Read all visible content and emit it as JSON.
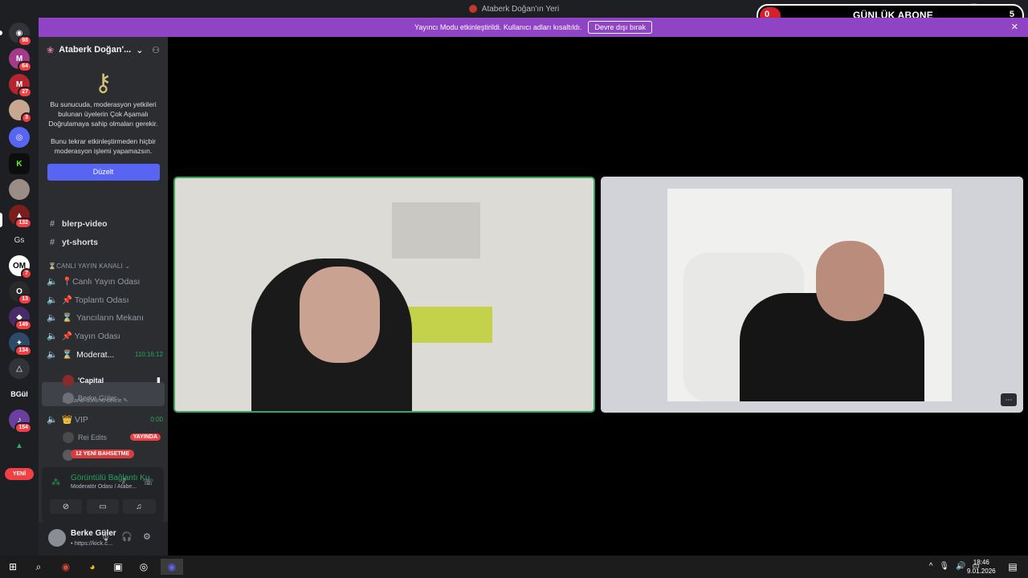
{
  "window": {
    "title": "Ataberk Doğan'ın Yeri"
  },
  "overlay": {
    "start": "0",
    "label": "GÜNLÜK ABONE",
    "goal": "5"
  },
  "banner": {
    "message": "Yayıncı Modu etkinleştirildi. Kullanıcı adları kısaltıldı.",
    "button": "Devre dışı bırak",
    "close": "✕"
  },
  "servers": [
    {
      "label": "98"
    },
    {
      "label": "64"
    },
    {
      "label": "27"
    },
    {
      "label": "3"
    },
    {
      "label": ""
    },
    {
      "label": ""
    },
    {
      "label": ""
    },
    {
      "label": "132"
    },
    {
      "abbr": "Gs"
    },
    {
      "label": "7"
    },
    {
      "label": "13"
    },
    {
      "label": "149"
    },
    {
      "label": "134"
    },
    {
      "label": ""
    },
    {
      "abbr": "BGül"
    },
    {
      "label": "154"
    }
  ],
  "rail": {
    "new_label": "YENİ"
  },
  "server": {
    "name": "Ataberk Doğan'...",
    "chevron": "⌄"
  },
  "mfa": {
    "text1": "Bu sunucuda, moderasyon yetkileri bulunan üyelerin Çok Aşamalı Doğrulamaya sahip olmaları gerekir.",
    "text2": "Bunu tekrar etkinleştirmeden hiçbir moderasyon işlemi yapamazsın.",
    "button": "Düzelt"
  },
  "text_channels": [
    "blerp-video",
    "yt-shorts"
  ],
  "category": "CANLI YAYIN KANALI",
  "voice_channels": [
    {
      "name": "📍Canlı Yayın Odası"
    },
    {
      "name": "📌 Toplantı Odası"
    },
    {
      "name": "Yancıların Mekanı"
    },
    {
      "name": "📌 Yayın Odası"
    }
  ],
  "moderator_channel": {
    "name": "Moderat...",
    "timer": "110:16:12",
    "status": "Bir kanal durumu belirle"
  },
  "mod_users": [
    {
      "name": "'Capital"
    },
    {
      "name": "Berke Güler"
    }
  ],
  "vip_channel": {
    "name": "👑 VIP",
    "timer": "0:00"
  },
  "vip_users": [
    {
      "name": "Rei Edits",
      "badge": "YAYINDA"
    }
  ],
  "mention_pill": "12 YENİ BAHSETME",
  "voice_panel": {
    "title": "Görüntülü Bağlantı Ku",
    "subtitle": "Moderatör Odası / Atabe..."
  },
  "user": {
    "name": "Berke Güler",
    "status": "• https://kick.c..."
  },
  "taskbar": {
    "time": "18:46",
    "date": "9.01.2026"
  }
}
